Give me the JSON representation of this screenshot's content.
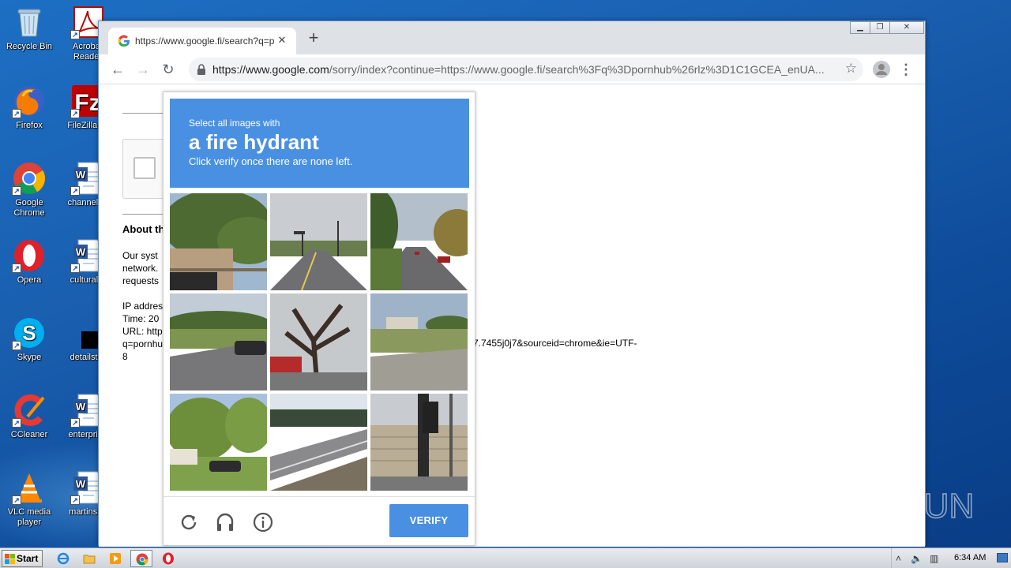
{
  "desktop": {
    "icons": [
      {
        "label": "Recycle Bin",
        "icon": "recycle-bin-icon"
      },
      {
        "label": "Acrobat Reader",
        "icon": "acrobat-icon"
      },
      {
        "label": "Firefox",
        "icon": "firefox-icon"
      },
      {
        "label": "FileZilla Cl",
        "icon": "filezilla-icon"
      },
      {
        "label": "Google Chrome",
        "icon": "chrome-icon"
      },
      {
        "label": "channelhe",
        "icon": "word-doc-icon"
      },
      {
        "label": "Opera",
        "icon": "opera-icon"
      },
      {
        "label": "culturalte",
        "icon": "word-doc-icon"
      },
      {
        "label": "Skype",
        "icon": "skype-icon"
      },
      {
        "label": "detailstru",
        "icon": "black-file-icon"
      },
      {
        "label": "CCleaner",
        "icon": "ccleaner-icon"
      },
      {
        "label": "enterprise",
        "icon": "word-doc-icon"
      },
      {
        "label": "VLC media player",
        "icon": "vlc-icon"
      },
      {
        "label": "martinsay",
        "icon": "word-doc-icon"
      }
    ]
  },
  "browser": {
    "tab_title": "https://www.google.fi/search?q=po",
    "url_domain": "https://www.google.com",
    "url_path": "/sorry/index?continue=https://www.google.fi/search%3Fq%3Dpornhub%26rlz%3D1C1GCEA_enUA..."
  },
  "page": {
    "about_heading": "About th",
    "para_lines": [
      "Our syst",
      "network.",
      "requests"
    ],
    "ip_lines": [
      "IP addres",
      "Time: 20",
      "URL: http",
      "q=pornhu",
      "8"
    ],
    "url_tail": "7.7455j0j7&sourceid=chrome&ie=UTF-"
  },
  "captcha": {
    "sub": "Select all images with",
    "target": "a fire hydrant",
    "hint": "Click verify once there are none left.",
    "verify_label": "VERIFY",
    "accent": "#4a90e2"
  },
  "watermark": {
    "text": "ANY RUN"
  },
  "taskbar": {
    "start_label": "Start",
    "clock": "6:34 AM"
  }
}
